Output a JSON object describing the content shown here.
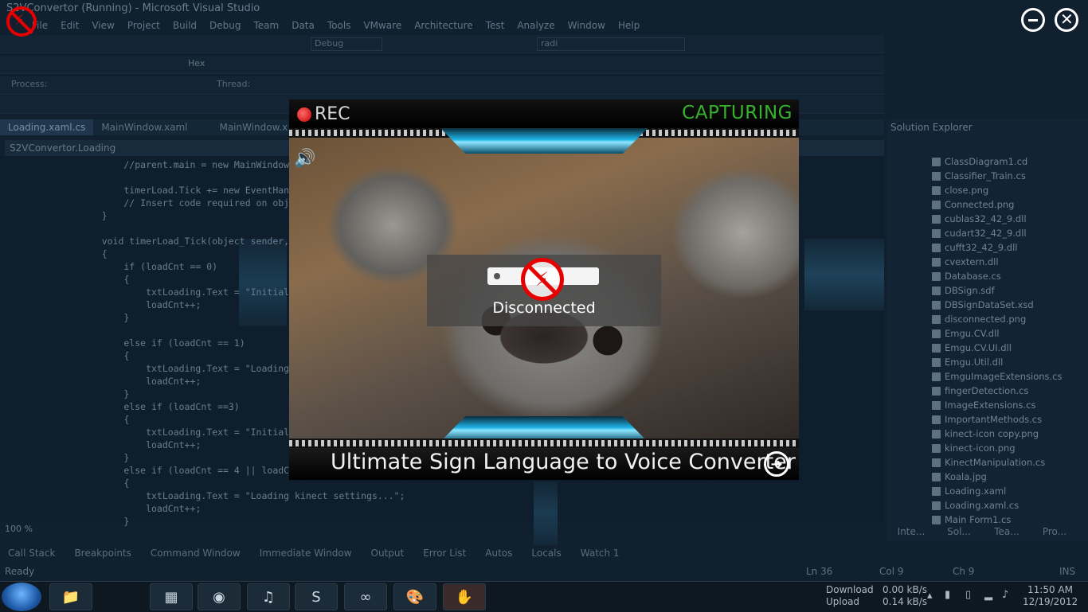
{
  "vs": {
    "title": "S2VConvertor (Running) - Microsoft Visual Studio",
    "menu": [
      "File",
      "Edit",
      "View",
      "Project",
      "Build",
      "Debug",
      "Team",
      "Data",
      "Tools",
      "VMware",
      "Architecture",
      "Test",
      "Analyze",
      "Window",
      "Help"
    ],
    "config": "Debug",
    "search_combo": "radi",
    "process_label": "Process:",
    "thread_label": "Thread:",
    "hex": "Hex",
    "tabs": [
      "Loading.xaml.cs",
      "MainWindow.xaml",
      "MainWindow.x"
    ],
    "nav_class": "S2VConvertor.Loading",
    "code": [
      "        //parent.main = new MainWindow(thi",
      "",
      "        timerLoad.Tick += new EventHandler",
      "        // Insert code required on object",
      "    }",
      "",
      "    void timerLoad_Tick(object sender, Eve",
      "    {",
      "        if (loadCnt == 0)",
      "        {",
      "            txtLoading.Text = \"Initializin",
      "            loadCnt++;",
      "        }",
      "",
      "        else if (loadCnt == 1)",
      "        {",
      "            txtLoading.Text = \"Loading",
      "            loadCnt++;",
      "        }",
      "        else if (loadCnt ==3)",
      "        {",
      "            txtLoading.Text = \"Initializin",
      "            loadCnt++;",
      "        }",
      "        else if (loadCnt == 4 || loadCnt =",
      "        {",
      "            txtLoading.Text = \"Loading kinect settings...\";",
      "            loadCnt++;",
      "        }"
    ],
    "zoom": "100 %",
    "bottom_panels": [
      "Call Stack",
      "Breakpoints",
      "Command Window",
      "Immediate Window",
      "Output",
      "Error List",
      "Autos",
      "Locals",
      "Watch 1"
    ],
    "status": {
      "ready": "Ready",
      "ln": "Ln 36",
      "col": "Col 9",
      "ch": "Ch 9",
      "ins": "INS"
    },
    "solution_explorer": {
      "title": "Solution Explorer",
      "items": [
        "ClassDiagram1.cd",
        "Classifier_Train.cs",
        "close.png",
        "Connected.png",
        "cublas32_42_9.dll",
        "cudart32_42_9.dll",
        "cufft32_42_9.dll",
        "cvextern.dll",
        "Database.cs",
        "DBSign.sdf",
        "DBSignDataSet.xsd",
        "disconnected.png",
        "Emgu.CV.dll",
        "Emgu.CV.UI.dll",
        "Emgu.Util.dll",
        "EmguImageExtensions.cs",
        "fingerDetection.cs",
        "ImageExtensions.cs",
        "ImportantMethods.cs",
        "kinect-icon copy.png",
        "kinect-icon.png",
        "KinectManipulation.cs",
        "Koala.jpg",
        "Loading.xaml",
        "Loading.xaml.cs",
        "Main Form1.cs"
      ],
      "tabs": [
        "Inte...",
        "Sol...",
        "Tea...",
        "Pro..."
      ]
    }
  },
  "app": {
    "rec_label": "REC",
    "status": "CAPTURING",
    "footer_title": "Ultimate Sign Language to Voice Converter",
    "popup_label": "Disconnected"
  },
  "taskbar": {
    "download_label": "Download",
    "upload_label": "Upload",
    "download_speed": "0.00 kB/s",
    "upload_speed": "0.14 kB/s",
    "time": "11:50 AM",
    "date": "12/19/2012"
  },
  "colors": {
    "capturing": "#36b22c",
    "rec": "#c40000",
    "accent_blue": "#1fb3e6"
  }
}
